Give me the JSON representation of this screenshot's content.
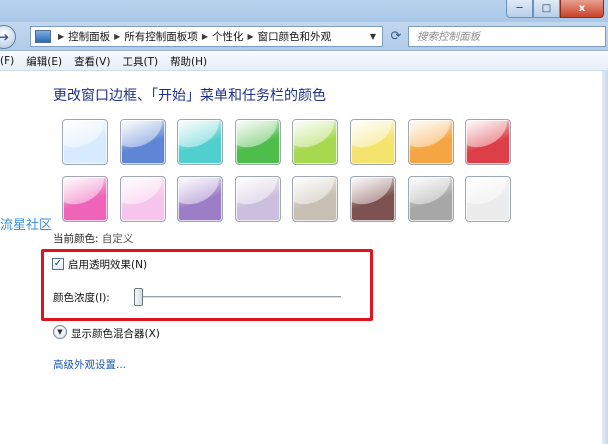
{
  "window": {
    "minimize": "─",
    "maximize": "□",
    "close": "x"
  },
  "address": {
    "crumbs": [
      "控制面板",
      "所有控制面板项",
      "个性化",
      "窗口颜色和外观"
    ],
    "search_placeholder": "搜索控制面板"
  },
  "menu": [
    "(F)",
    "编辑(E)",
    "查看(V)",
    "工具(T)",
    "帮助(H)"
  ],
  "heading": "更改窗口边框、「开始」菜单和任务栏的颜色",
  "swatches": [
    {
      "name": "sky",
      "color": "#d7eaff"
    },
    {
      "name": "twilight",
      "color": "#5f86d4"
    },
    {
      "name": "sea",
      "color": "#51cfcf"
    },
    {
      "name": "leaf",
      "color": "#4fbd4a"
    },
    {
      "name": "lime",
      "color": "#a6d94f"
    },
    {
      "name": "lemon",
      "color": "#f4e36d"
    },
    {
      "name": "pumpkin",
      "color": "#f5a642"
    },
    {
      "name": "ruby",
      "color": "#dd3f48"
    },
    {
      "name": "fuchsia",
      "color": "#ef63b8"
    },
    {
      "name": "blush",
      "color": "#f6c4ec"
    },
    {
      "name": "violet",
      "color": "#9b7ec6"
    },
    {
      "name": "lavender",
      "color": "#ccbfdd"
    },
    {
      "name": "taupe",
      "color": "#c7bfb2"
    },
    {
      "name": "chocolate",
      "color": "#7d5250"
    },
    {
      "name": "slate",
      "color": "#a7a7a7"
    },
    {
      "name": "frost",
      "color": "#ececec"
    }
  ],
  "side_text": "流星社区",
  "current_color": {
    "label": "当前颜色:",
    "value": "自定义"
  },
  "transparency": {
    "checked": true,
    "check_mark": "✓",
    "label": "启用透明效果(N)"
  },
  "intensity": {
    "label": "颜色浓度(I):",
    "value": 0
  },
  "mixer": {
    "icon": "chevron-down-icon",
    "label": "显示颜色混合器(X)"
  },
  "advanced_link": "高级外观设置..."
}
